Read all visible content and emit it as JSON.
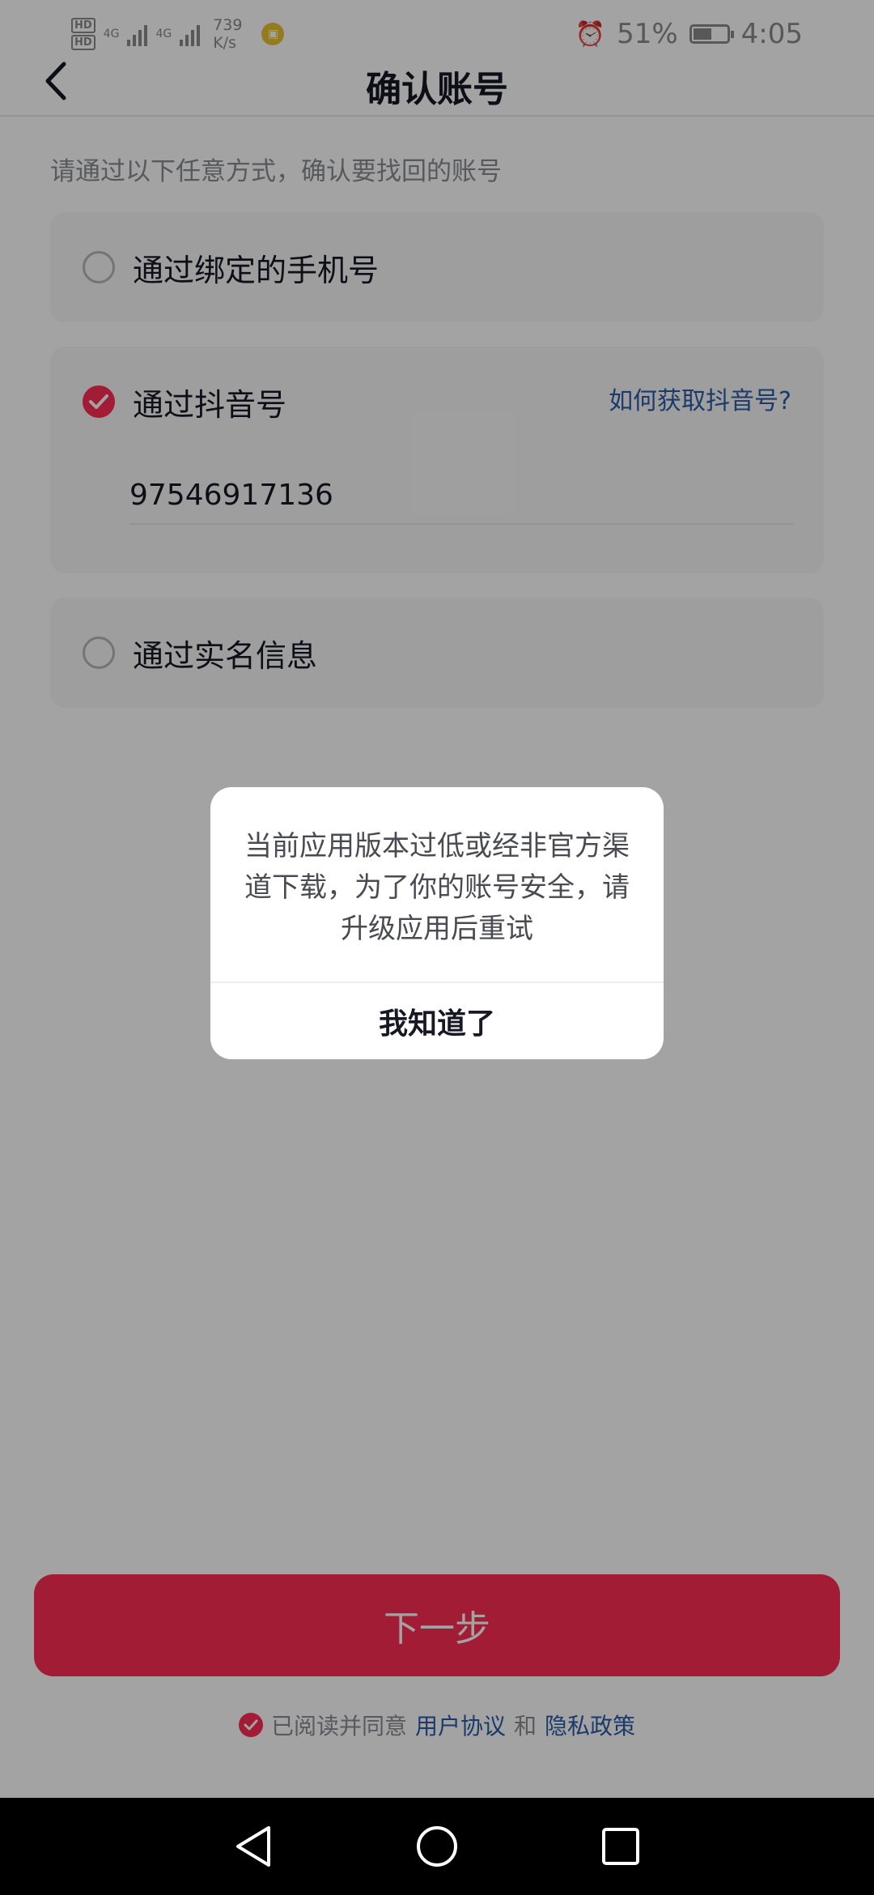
{
  "status_bar": {
    "net_speed_value": "739",
    "net_speed_unit": "K/s",
    "signal_label_1": "4G",
    "signal_label_2": "4G",
    "battery": "51%",
    "time": "4:05"
  },
  "header": {
    "title": "确认账号"
  },
  "hint": "请通过以下任意方式，确认要找回的账号",
  "options": [
    {
      "label": "通过绑定的手机号",
      "selected": false
    },
    {
      "label": "通过抖音号",
      "selected": true,
      "help_link": "如何获取抖音号?",
      "value": "97546917136"
    },
    {
      "label": "通过实名信息",
      "selected": false
    }
  ],
  "next_button": "下一步",
  "agreement": {
    "prefix": "已阅读并同意",
    "user_agreement": "用户协议",
    "and": "和",
    "privacy_policy": "隐私政策"
  },
  "dialog": {
    "message": "当前应用版本过低或经非官方渠道下载，为了你的账号安全，请升级应用后重试",
    "confirm": "我知道了"
  },
  "colors": {
    "accent": "#fe2c55",
    "link": "#2a5ca8",
    "overlay": "rgba(0,0,0,0.36)"
  },
  "icons": [
    "back-arrow-icon",
    "check-icon",
    "nav-back-icon",
    "nav-home-icon",
    "nav-recent-icon"
  ]
}
